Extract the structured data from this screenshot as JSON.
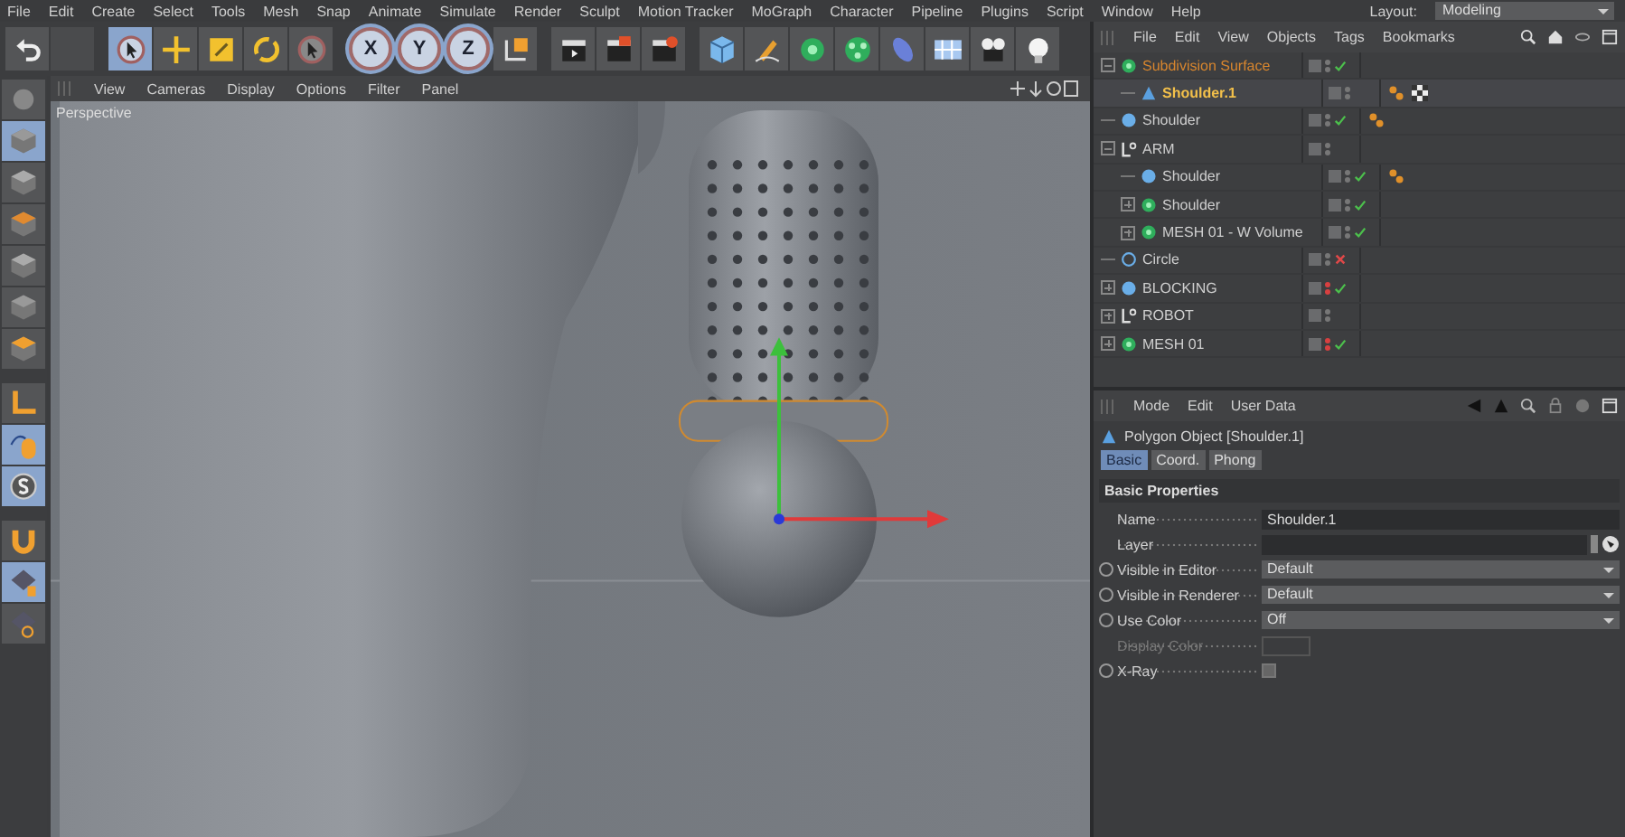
{
  "menu": [
    "File",
    "Edit",
    "Create",
    "Select",
    "Tools",
    "Mesh",
    "Snap",
    "Animate",
    "Simulate",
    "Render",
    "Sculpt",
    "Motion Tracker",
    "MoGraph",
    "Character",
    "Pipeline",
    "Plugins",
    "Script",
    "Window",
    "Help"
  ],
  "layout": {
    "label": "Layout:",
    "value": "Modeling"
  },
  "axis_lock": [
    {
      "label": "X",
      "selected": true
    },
    {
      "label": "Y",
      "selected": true
    },
    {
      "label": "Z",
      "selected": true
    }
  ],
  "viewport": {
    "menu": [
      "View",
      "Cameras",
      "Display",
      "Options",
      "Filter",
      "Panel"
    ],
    "camera": "Perspective"
  },
  "object_manager": {
    "menu": [
      "File",
      "Edit",
      "View",
      "Objects",
      "Tags",
      "Bookmarks"
    ],
    "objects": [
      {
        "name": "Subdivision Surface",
        "kind": "subdivision",
        "selected": false,
        "parent_of_selected": true,
        "expanded": true,
        "enabled": true,
        "hidden": false,
        "children": [
          {
            "name": "Shoulder.1",
            "kind": "polygon",
            "selected": true,
            "parent_of_selected": false,
            "hidden": false,
            "tags": [
              {
                "kind": "phong"
              },
              {
                "kind": "checker"
              }
            ]
          }
        ]
      },
      {
        "name": "Shoulder",
        "kind": "sphere",
        "selected": false,
        "parent_of_selected": false,
        "enabled": true,
        "hidden": false,
        "tags": [
          {
            "kind": "phong"
          }
        ]
      },
      {
        "name": "ARM",
        "kind": "null",
        "selected": false,
        "parent_of_selected": false,
        "expanded": true,
        "hidden": false,
        "children": [
          {
            "name": "Shoulder",
            "kind": "sphere",
            "selected": false,
            "parent_of_selected": false,
            "enabled": true,
            "hidden": false,
            "tags": [
              {
                "kind": "phong"
              }
            ]
          },
          {
            "name": "Shoulder",
            "kind": "subdivision",
            "selected": false,
            "parent_of_selected": false,
            "expanded": false,
            "enabled": true,
            "hidden": false
          },
          {
            "name": "MESH 01 - W Volume",
            "kind": "subdivision",
            "selected": false,
            "parent_of_selected": false,
            "expanded": false,
            "enabled": true,
            "hidden": false
          }
        ]
      },
      {
        "name": "Circle",
        "kind": "spline",
        "selected": false,
        "parent_of_selected": false,
        "enabled": false,
        "hidden": false
      },
      {
        "name": "BLOCKING",
        "kind": "sphere",
        "selected": false,
        "parent_of_selected": false,
        "expanded": false,
        "enabled": true,
        "hidden": true
      },
      {
        "name": "ROBOT",
        "kind": "null",
        "selected": false,
        "parent_of_selected": false,
        "expanded": false,
        "hidden": false
      },
      {
        "name": "MESH 01",
        "kind": "subdivision",
        "selected": false,
        "parent_of_selected": false,
        "expanded": false,
        "enabled": true,
        "hidden": true
      }
    ]
  },
  "attributes": {
    "menu": [
      "Mode",
      "Edit",
      "User Data"
    ],
    "object_title": "Polygon Object [Shoulder.1]",
    "tabs": [
      {
        "label": "Basic",
        "selected": true
      },
      {
        "label": "Coord.",
        "selected": false
      },
      {
        "label": "Phong",
        "selected": false
      }
    ],
    "section": "Basic Properties",
    "fields": [
      {
        "kind": "text",
        "label": "Name",
        "value": "Shoulder.1",
        "animatable": false,
        "disabled": false
      },
      {
        "kind": "link",
        "label": "Layer",
        "animatable": false,
        "disabled": false
      },
      {
        "kind": "dropdown",
        "label": "Visible in Editor",
        "value": "Default",
        "animatable": true,
        "disabled": false
      },
      {
        "kind": "dropdown",
        "label": "Visible in Renderer",
        "value": "Default",
        "animatable": true,
        "disabled": false
      },
      {
        "kind": "dropdown",
        "label": "Use Color",
        "value": "Off",
        "animatable": true,
        "disabled": false
      },
      {
        "kind": "color",
        "label": "Display Color",
        "animatable": false,
        "disabled": true
      },
      {
        "kind": "checkbox",
        "label": "X-Ray",
        "checked": false,
        "animatable": true,
        "disabled": false
      }
    ]
  }
}
